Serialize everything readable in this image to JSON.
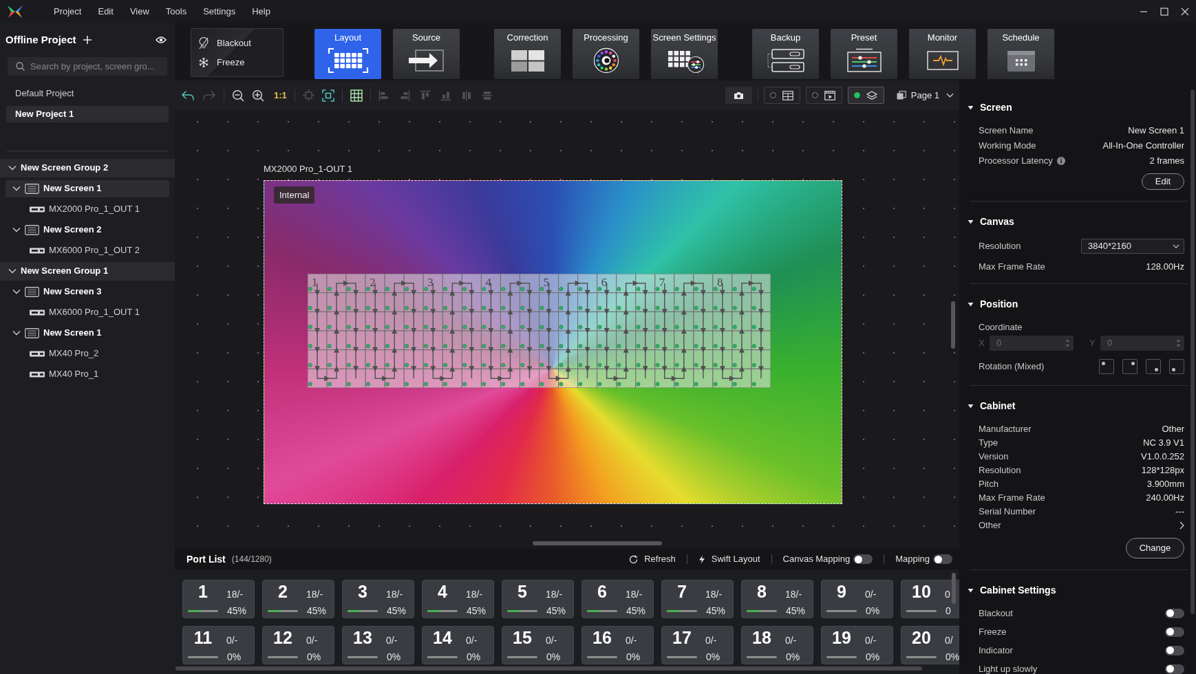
{
  "menu": {
    "items": [
      "Project",
      "Edit",
      "View",
      "Tools",
      "Settings",
      "Help"
    ]
  },
  "sidebar": {
    "title": "Offline Project",
    "search": {
      "placeholder": "Search by project, screen gro..."
    },
    "projects": [
      {
        "name": "Default Project",
        "selected": false
      },
      {
        "name": "New Project 1",
        "selected": true
      }
    ],
    "tree": [
      {
        "label": "New Screen Group 2",
        "expanded": true,
        "children": [
          {
            "label": "New Screen 1",
            "expanded": true,
            "selected": true,
            "children": [
              {
                "label": "MX2000 Pro_1_OUT 1",
                "selected": false
              }
            ]
          },
          {
            "label": "New Screen 2",
            "expanded": true,
            "selected": false,
            "children": [
              {
                "label": "MX6000 Pro_1_OUT 2",
                "selected": false
              }
            ]
          }
        ]
      },
      {
        "label": "New Screen Group 1",
        "expanded": true,
        "children": [
          {
            "label": "New Screen 3",
            "expanded": true,
            "selected": false,
            "children": [
              {
                "label": "MX6000 Pro_1_OUT 1",
                "selected": false
              }
            ]
          },
          {
            "label": "New Screen 1",
            "expanded": true,
            "selected": false,
            "children": [
              {
                "label": "MX40 Pro_2",
                "selected": false
              },
              {
                "label": "MX40 Pro_1",
                "selected": false
              }
            ]
          }
        ]
      }
    ]
  },
  "toolbar": {
    "quick": [
      {
        "kind": "blackout",
        "label": "Blackout"
      },
      {
        "kind": "freeze",
        "label": "Freeze"
      }
    ],
    "groups": [
      [
        {
          "kind": "layout",
          "label": "Layout",
          "selected": true
        },
        {
          "kind": "source",
          "label": "Source",
          "selected": false
        }
      ],
      [
        {
          "kind": "correction",
          "label": "Correction",
          "selected": false
        },
        {
          "kind": "processing",
          "label": "Processing",
          "selected": false
        },
        {
          "kind": "screen",
          "label": "Screen Settings",
          "selected": false
        }
      ],
      [
        {
          "kind": "backup",
          "label": "Backup",
          "selected": false
        },
        {
          "kind": "preset",
          "label": "Preset",
          "selected": false
        },
        {
          "kind": "monitor",
          "label": "Monitor",
          "selected": false
        },
        {
          "kind": "schedule",
          "label": "Schedule",
          "selected": false
        }
      ]
    ]
  },
  "canvas_toolbar": {
    "tool_groups": [
      [
        {
          "kind": "undo",
          "disabled": false
        },
        {
          "kind": "redo",
          "disabled": true
        }
      ],
      [
        {
          "kind": "zoom_out",
          "disabled": false
        },
        {
          "kind": "zoom_in",
          "disabled": false
        },
        {
          "kind": "actual_size",
          "label": "1:1",
          "disabled": false
        }
      ],
      [
        {
          "kind": "fit_selection",
          "disabled": true
        },
        {
          "kind": "fit_canvas",
          "disabled": false
        }
      ],
      [
        {
          "kind": "grid",
          "disabled": false
        }
      ],
      [
        {
          "kind": "align_left",
          "disabled": true
        },
        {
          "kind": "align_right",
          "disabled": true
        },
        {
          "kind": "align_top",
          "disabled": true
        },
        {
          "kind": "align_bottom",
          "disabled": true
        },
        {
          "kind": "align_center",
          "disabled": true
        },
        {
          "kind": "align_middle",
          "disabled": true
        }
      ]
    ],
    "view_toggles": [
      {
        "kind": "window",
        "on": false
      },
      {
        "kind": "video",
        "on": false
      },
      {
        "kind": "layers",
        "on": true
      }
    ],
    "page": "Page 1"
  },
  "canvas": {
    "output_label": "MX2000 Pro_1-OUT 1",
    "badge": "Internal",
    "ports": [
      {
        "number": "1"
      },
      {
        "number": "2"
      },
      {
        "number": "3"
      },
      {
        "number": "4"
      },
      {
        "number": "5"
      },
      {
        "number": "6"
      },
      {
        "number": "7"
      },
      {
        "number": "8"
      }
    ]
  },
  "port_list": {
    "title": "Port List",
    "count": "(144/1280)",
    "actions": [
      {
        "kind": "refresh",
        "label": "Refresh"
      },
      {
        "kind": "swift",
        "label": "Swift Layout"
      }
    ],
    "switches": [
      {
        "label": "Canvas Mapping",
        "on": false
      },
      {
        "label": "Mapping",
        "on": false
      }
    ],
    "rows": [
      [
        {
          "number": "1",
          "count": "18/-",
          "percent": "45%",
          "level": 0.45
        },
        {
          "number": "2",
          "count": "18/-",
          "percent": "45%",
          "level": 0.45
        },
        {
          "number": "3",
          "count": "18/-",
          "percent": "45%",
          "level": 0.45
        },
        {
          "number": "4",
          "count": "18/-",
          "percent": "45%",
          "level": 0.45
        },
        {
          "number": "5",
          "count": "18/-",
          "percent": "45%",
          "level": 0.45
        },
        {
          "number": "6",
          "count": "18/-",
          "percent": "45%",
          "level": 0.45
        },
        {
          "number": "7",
          "count": "18/-",
          "percent": "45%",
          "level": 0.45
        },
        {
          "number": "8",
          "count": "18/-",
          "percent": "45%",
          "level": 0.45
        },
        {
          "number": "9",
          "count": "0/-",
          "percent": "0%",
          "level": 0
        },
        {
          "number": "10",
          "count": "0",
          "percent": "0",
          "level": 0
        }
      ],
      [
        {
          "number": "11",
          "count": "0/-",
          "percent": "0%",
          "level": 0
        },
        {
          "number": "12",
          "count": "0/-",
          "percent": "0%",
          "level": 0
        },
        {
          "number": "13",
          "count": "0/-",
          "percent": "0%",
          "level": 0
        },
        {
          "number": "14",
          "count": "0/-",
          "percent": "0%",
          "level": 0
        },
        {
          "number": "15",
          "count": "0/-",
          "percent": "0%",
          "level": 0
        },
        {
          "number": "16",
          "count": "0/-",
          "percent": "0%",
          "level": 0
        },
        {
          "number": "17",
          "count": "0/-",
          "percent": "0%",
          "level": 0
        },
        {
          "number": "18",
          "count": "0/-",
          "percent": "0%",
          "level": 0
        },
        {
          "number": "19",
          "count": "0/-",
          "percent": "0%",
          "level": 0
        },
        {
          "number": "20",
          "count": "0/",
          "percent": "0%",
          "level": 0
        }
      ]
    ]
  },
  "properties": {
    "sections": [
      {
        "kind": "screen",
        "title": "Screen",
        "expanded": true,
        "rows": [
          {
            "label": "Screen Name",
            "value": "New Screen 1"
          },
          {
            "label": "Working Mode",
            "value": "All-In-One Controller"
          },
          {
            "label": "Processor Latency",
            "value": "2 frames",
            "info": true
          }
        ],
        "button": "Edit"
      },
      {
        "kind": "canvas",
        "title": "Canvas",
        "expanded": true,
        "select": {
          "label": "Resolution",
          "value": "3840*2160"
        },
        "rows": [
          {
            "label": "Max Frame Rate",
            "value": "128.00Hz"
          }
        ]
      },
      {
        "kind": "position",
        "title": "Position",
        "expanded": true,
        "coordinate": {
          "label": "Coordinate",
          "disabled": true,
          "fields": [
            {
              "axis": "X",
              "value": "0"
            },
            {
              "axis": "Y",
              "value": "0"
            }
          ]
        },
        "rotation": {
          "label": "Rotation (Mixed)",
          "options": [
            {
              "kind": "top_left",
              "selected": false
            },
            {
              "kind": "top_right",
              "selected": false
            },
            {
              "kind": "bottom_right",
              "selected": false
            },
            {
              "kind": "bottom_left",
              "selected": false
            }
          ]
        }
      },
      {
        "kind": "cabinet",
        "title": "Cabinet",
        "expanded": true,
        "rows": [
          {
            "label": "Manufacturer",
            "value": "Other"
          },
          {
            "label": "Type",
            "value": "NC 3.9 V1"
          },
          {
            "label": "Version",
            "value": "V1.0.0.252"
          },
          {
            "label": "Resolution",
            "value": "128*128px"
          },
          {
            "label": "Pitch",
            "value": "3.900mm"
          },
          {
            "label": "Max Frame Rate",
            "value": "240.00Hz"
          },
          {
            "label": "Serial Number",
            "value": "---"
          }
        ],
        "link": {
          "label": "Other"
        },
        "button": "Change"
      },
      {
        "kind": "settings",
        "title": "Cabinet Settings",
        "expanded": true,
        "switches": [
          {
            "label": "Blackout",
            "on": false
          },
          {
            "label": "Freeze",
            "on": false
          },
          {
            "label": "Indicator",
            "on": false
          },
          {
            "label": "Light up slowly",
            "on": false
          }
        ]
      }
    ]
  }
}
